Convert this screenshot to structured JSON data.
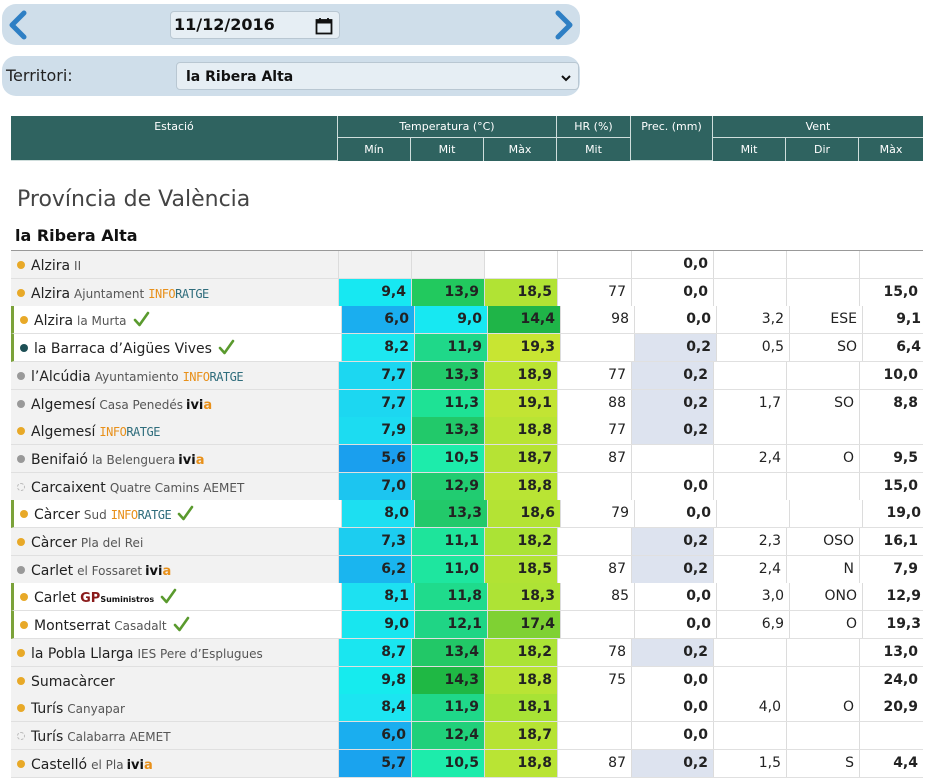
{
  "date": "11/12/2016",
  "territory": {
    "label": "Territori:",
    "selected": "la Ribera Alta"
  },
  "header": {
    "station": "Estació",
    "temperature": "Temperatura (°C)",
    "hr": "HR (%)",
    "prec": "Prec. (mm)",
    "wind": "Vent",
    "sub": {
      "t_min": "Mín",
      "t_mit": "Mit",
      "t_max": "Màx",
      "hr_mit": "Mit",
      "w_mit": "Mit",
      "w_dir": "Dir",
      "w_max": "Màx"
    }
  },
  "section_title": "Província de València",
  "region_title": "la Ribera Alta",
  "colors": {
    "header_bg": "#2f6360",
    "dot_orange": "#e8a928",
    "dot_grey": "#999999",
    "dot_darkteal": "#1d4f55",
    "check_green": "#5a9a2e",
    "prec_bg": "#dde3ef"
  },
  "rows": [
    {
      "name": "Alzira",
      "sub": "II",
      "brand": "",
      "dot": "orange",
      "check": false,
      "hl": false,
      "tmin": "",
      "tmit": "",
      "tmax": "",
      "hr": "",
      "prec": "0,0",
      "wmit": "",
      "wdir": "",
      "wmax": "",
      "cmin": "",
      "cmit": "",
      "cmax": "",
      "precbg": false
    },
    {
      "name": "Alzira",
      "sub": "Ajuntament",
      "brand": "inforatge",
      "dot": "orange",
      "check": false,
      "hl": false,
      "tmin": "9,4",
      "tmit": "13,9",
      "tmax": "18,5",
      "hr": "77",
      "prec": "0,0",
      "wmit": "",
      "wdir": "",
      "wmax": "15,0",
      "cmin": "#17e8f2",
      "cmit": "#22c95e",
      "cmax": "#b1e334",
      "precbg": false
    },
    {
      "name": "Alzira",
      "sub": "la Murta",
      "brand": "",
      "dot": "orange",
      "check": true,
      "hl": true,
      "tmin": "6,0",
      "tmit": "9,0",
      "tmax": "14,4",
      "hr": "98",
      "prec": "0,0",
      "wmit": "3,2",
      "wdir": "ESE",
      "wmax": "9,1",
      "cmin": "#1aaeef",
      "cmit": "#17e8f2",
      "cmax": "#1fb548",
      "precbg": false
    },
    {
      "name": "la Barraca d’Aigües Vives",
      "sub": "",
      "brand": "",
      "dot": "darkteal",
      "check": true,
      "hl": true,
      "tmin": "8,2",
      "tmit": "11,9",
      "tmax": "19,3",
      "hr": "",
      "prec": "0,2",
      "wmit": "0,5",
      "wdir": "SO",
      "wmax": "6,4",
      "cmin": "#1de7f0",
      "cmit": "#1fd889",
      "cmax": "#c8e532",
      "precbg": true
    },
    {
      "name": "l’Alcúdia",
      "sub": "Ayuntamiento",
      "brand": "inforatge",
      "dot": "grey",
      "check": false,
      "hl": false,
      "tmin": "7,7",
      "tmit": "13,3",
      "tmax": "18,9",
      "hr": "77",
      "prec": "0,2",
      "wmit": "",
      "wdir": "",
      "wmax": "10,0",
      "cmin": "#1cd7f1",
      "cmit": "#22c96a",
      "cmax": "#bbe433",
      "precbg": true
    },
    {
      "name": "Algemesí",
      "sub": "Casa Penedés",
      "brand": "ivia",
      "dot": "grey",
      "check": false,
      "hl": false,
      "tmin": "7,7",
      "tmit": "11,3",
      "tmax": "19,1",
      "hr": "88",
      "prec": "0,2",
      "wmit": "1,7",
      "wdir": "SO",
      "wmax": "8,8",
      "cmin": "#1cd7f1",
      "cmit": "#1ee295",
      "cmax": "#c2e433",
      "precbg": true
    },
    {
      "name": "Algemesí",
      "sub": "",
      "brand": "inforatge",
      "dot": "orange",
      "check": false,
      "hl": false,
      "tmin": "7,9",
      "tmit": "13,3",
      "tmax": "18,8",
      "hr": "77",
      "prec": "0,2",
      "wmit": "",
      "wdir": "",
      "wmax": "",
      "cmin": "#1cdcf1",
      "cmit": "#22c96a",
      "cmax": "#b9e434",
      "precbg": true
    },
    {
      "name": "Benifaió",
      "sub": "la Belenguera",
      "brand": "ivia",
      "dot": "grey",
      "check": false,
      "hl": false,
      "tmin": "5,6",
      "tmit": "10,5",
      "tmax": "18,7",
      "hr": "87",
      "prec": "",
      "wmit": "2,4",
      "wdir": "O",
      "wmax": "9,5",
      "cmin": "#1a9fee",
      "cmit": "#1decab",
      "cmax": "#b6e334",
      "precbg": false
    },
    {
      "name": "Carcaixent",
      "sub": "Quatre Camins AEMET",
      "brand": "",
      "dot": "empty",
      "check": false,
      "hl": false,
      "tmin": "7,0",
      "tmit": "12,9",
      "tmax": "18,8",
      "hr": "",
      "prec": "0,0",
      "wmit": "",
      "wdir": "",
      "wmax": "15,0",
      "cmin": "#1cc5f0",
      "cmit": "#21cc71",
      "cmax": "#b9e434",
      "precbg": false
    },
    {
      "name": "Càrcer",
      "sub": "Sud",
      "brand": "inforatge",
      "dot": "orange",
      "check": true,
      "hl": true,
      "tmin": "8,0",
      "tmit": "13,3",
      "tmax": "18,6",
      "hr": "79",
      "prec": "0,0",
      "wmit": "",
      "wdir": "",
      "wmax": "19,0",
      "cmin": "#1ddff1",
      "cmit": "#22c96a",
      "cmax": "#b4e334",
      "precbg": false
    },
    {
      "name": "Càrcer",
      "sub": "Pla del Rei",
      "brand": "",
      "dot": "orange",
      "check": false,
      "hl": false,
      "tmin": "7,3",
      "tmit": "11,1",
      "tmax": "18,2",
      "hr": "",
      "prec": "0,2",
      "wmit": "2,3",
      "wdir": "OSO",
      "wmax": "16,1",
      "cmin": "#1ccdf0",
      "cmit": "#1ee49b",
      "cmax": "#abe335",
      "precbg": true
    },
    {
      "name": "Carlet",
      "sub": "el Fossaret",
      "brand": "ivia",
      "dot": "grey",
      "check": false,
      "hl": false,
      "tmin": "6,2",
      "tmit": "11,0",
      "tmax": "18,5",
      "hr": "87",
      "prec": "0,2",
      "wmit": "2,4",
      "wdir": "N",
      "wmax": "7,9",
      "cmin": "#1ab5ef",
      "cmit": "#1ee69f",
      "cmax": "#b1e334",
      "precbg": true
    },
    {
      "name": "Carlet",
      "sub": "",
      "brand": "gp",
      "dot": "orange",
      "check": true,
      "hl": true,
      "tmin": "8,1",
      "tmit": "11,8",
      "tmax": "18,3",
      "hr": "85",
      "prec": "0,0",
      "wmit": "3,0",
      "wdir": "ONO",
      "wmax": "12,9",
      "cmin": "#1de1f1",
      "cmit": "#1fdb8c",
      "cmax": "#aee335",
      "precbg": false
    },
    {
      "name": "Montserrat",
      "sub": "Casadalt",
      "brand": "",
      "dot": "orange",
      "check": true,
      "hl": true,
      "tmin": "9,0",
      "tmit": "12,1",
      "tmax": "17,4",
      "hr": "",
      "prec": "0,0",
      "wmit": "6,9",
      "wdir": "O",
      "wmax": "19,3",
      "cmin": "#18e6ef",
      "cmit": "#1fd585",
      "cmax": "#7fd133",
      "precbg": false
    },
    {
      "name": "la Pobla Llarga",
      "sub": "IES Pere d’Esplugues",
      "brand": "",
      "dot": "orange",
      "check": false,
      "hl": false,
      "tmin": "8,7",
      "tmit": "13,4",
      "tmax": "18,2",
      "hr": "78",
      "prec": "0,2",
      "wmit": "",
      "wdir": "",
      "wmax": "13,0",
      "cmin": "#1ae6f0",
      "cmit": "#22c867",
      "cmax": "#abe335",
      "precbg": true
    },
    {
      "name": "Sumacàrcer",
      "sub": "",
      "brand": "",
      "dot": "orange",
      "check": false,
      "hl": false,
      "tmin": "9,8",
      "tmit": "14,3",
      "tmax": "18,8",
      "hr": "75",
      "prec": "0,0",
      "wmit": "",
      "wdir": "",
      "wmax": "24,0",
      "cmin": "#16ebee",
      "cmit": "#1fb844",
      "cmax": "#b9e434",
      "precbg": false
    },
    {
      "name": "Turís",
      "sub": "Canyapar",
      "brand": "",
      "dot": "orange",
      "check": false,
      "hl": false,
      "tmin": "8,4",
      "tmit": "11,9",
      "tmax": "18,1",
      "hr": "",
      "prec": "0,0",
      "wmit": "4,0",
      "wdir": "O",
      "wmax": "20,9",
      "cmin": "#1ce5f1",
      "cmit": "#1fd889",
      "cmax": "#a8e335",
      "precbg": false
    },
    {
      "name": "Turís",
      "sub": "Calabarra AEMET",
      "brand": "",
      "dot": "empty",
      "check": false,
      "hl": false,
      "tmin": "6,0",
      "tmit": "12,4",
      "tmax": "18,7",
      "hr": "",
      "prec": "0,0",
      "wmit": "",
      "wdir": "",
      "wmax": "",
      "cmin": "#1aaeef",
      "cmit": "#20d07a",
      "cmax": "#b6e334",
      "precbg": false
    },
    {
      "name": "Castelló",
      "sub": "el Pla",
      "brand": "ivia",
      "dot": "orange",
      "check": false,
      "hl": false,
      "tmin": "5,7",
      "tmit": "10,5",
      "tmax": "18,8",
      "hr": "87",
      "prec": "0,2",
      "wmit": "1,5",
      "wdir": "S",
      "wmax": "4,4",
      "cmin": "#1aa3ee",
      "cmit": "#1decab",
      "cmax": "#b9e434",
      "precbg": true
    }
  ],
  "brands": {
    "info_a": "INFO",
    "info_b": "RATGE",
    "ivia_a": "ivi",
    "ivia_b": "a",
    "gp_a": "GP",
    "gp_b": "Suministros"
  }
}
